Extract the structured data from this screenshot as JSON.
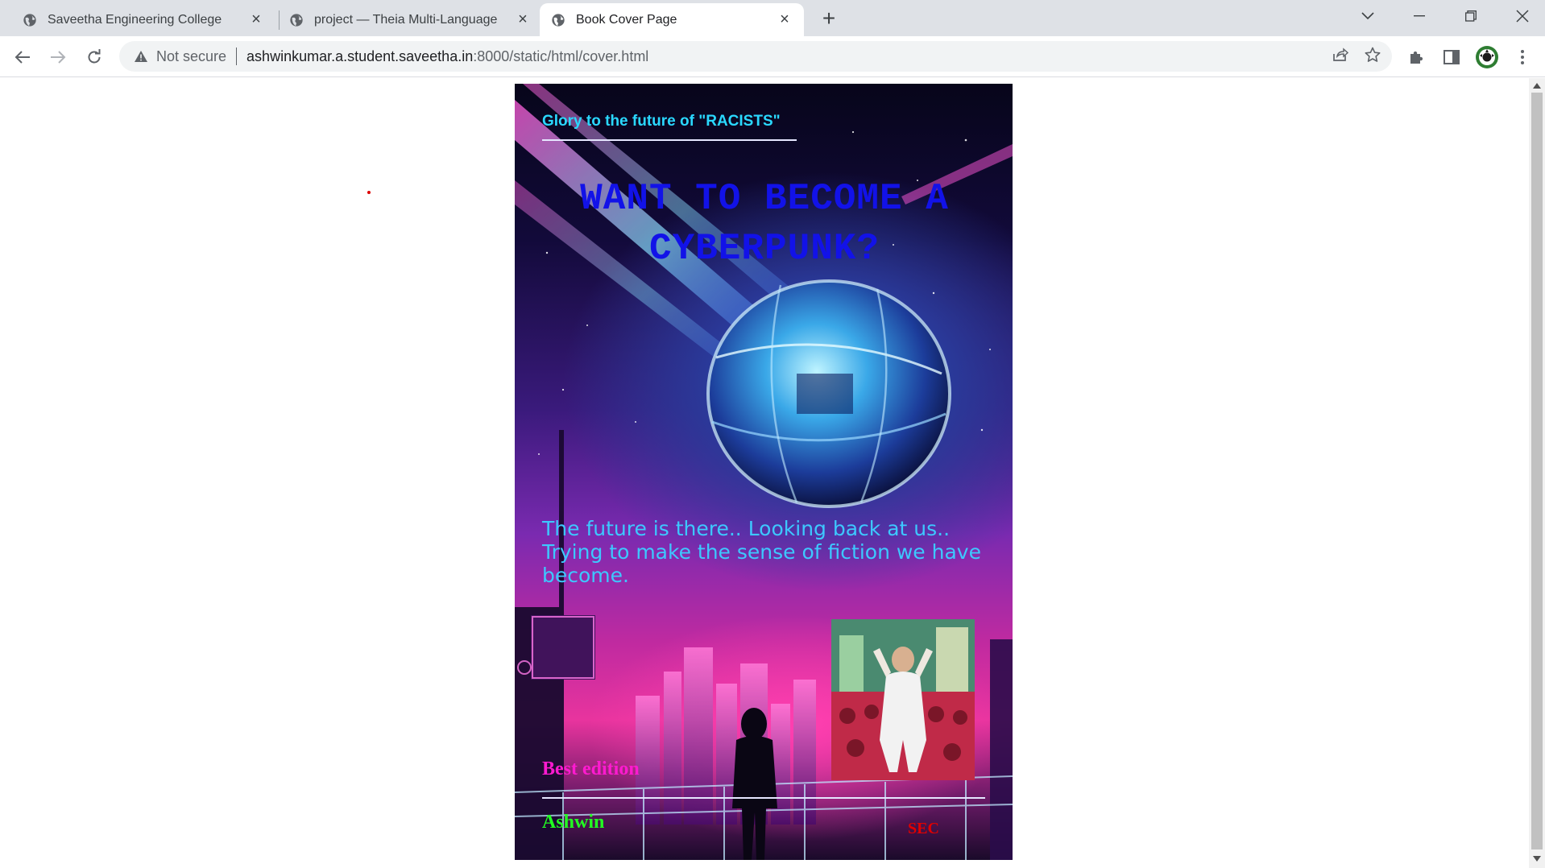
{
  "browser": {
    "tabs": [
      {
        "title": "Saveetha Engineering College",
        "icon": "globe-icon",
        "active": false
      },
      {
        "title": "project — Theia Multi-Language",
        "icon": "globe-icon",
        "active": false
      },
      {
        "title": "Book Cover Page",
        "icon": "globe-icon",
        "active": true
      }
    ],
    "new_tab_label": "+",
    "security_label": "Not secure",
    "url_host": "ashwinkumar.a.student.saveetha.in",
    "url_path": ":8000/static/html/cover.html"
  },
  "cover": {
    "top_line": "Glory to the future of \"RACISTS\"",
    "title": "WANT TO BECOME A CYBERPUNK?",
    "tagline": "The future is there.. Looking back at us.. Trying to make the sense of fiction we have become.",
    "edition": "Best edition",
    "author": "Ashwin",
    "publisher": "SEC",
    "colors": {
      "top_line": "#2ad8ff",
      "title": "#1212e8",
      "tagline": "#3dc8ff",
      "edition": "#ff1ad0",
      "author": "#22ff22",
      "publisher": "#e00000"
    }
  }
}
